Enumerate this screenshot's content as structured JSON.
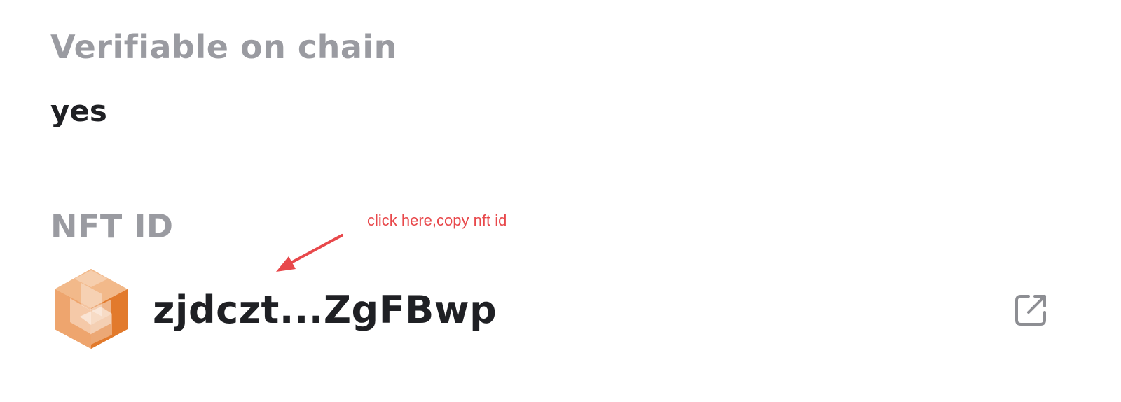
{
  "sections": [
    {
      "label": "Verifiable on chain",
      "value": "yes"
    },
    {
      "label": "NFT ID",
      "value": "zjdczt...ZgFBwp"
    }
  ],
  "annotation": {
    "text": "click here,copy nft id"
  },
  "icons": {
    "nft_logo": "hexagon-cube-icon",
    "open_link": "external-link-icon",
    "arrow": "arrow-icon"
  },
  "colors": {
    "label": "#9a9ba1",
    "value": "#1f2024",
    "annotation": "#e8484b",
    "icon_stroke": "#8d8e93",
    "logo_orange": "#e8883e"
  }
}
